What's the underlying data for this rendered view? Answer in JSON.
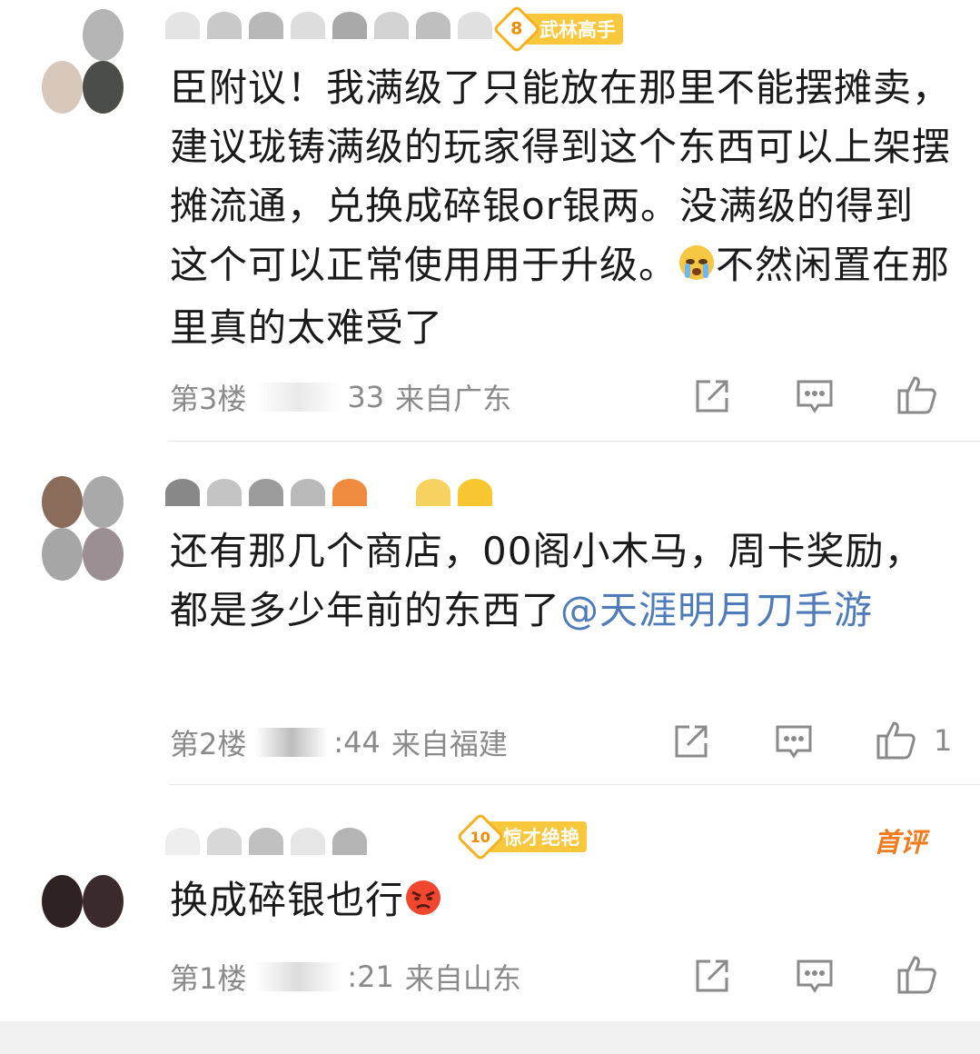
{
  "comments": [
    {
      "floor": "第3楼",
      "time": "33",
      "location": "来自广东",
      "badge_level": "8",
      "badge_title": "武林高手",
      "text": "臣附议！我满级了只能放在那里不能摆摊卖，建议珑铸满级的玩家得到这个东西可以上架摆摊流通，兑换成碎银or银两。没满级的得到这个可以正常使用用于升级。",
      "emoji": "crying-emoji",
      "text_after_emoji": "不然闲置在那里真的太难受了",
      "likes": ""
    },
    {
      "floor": "第2楼",
      "time": ":44",
      "location": "来自福建",
      "text": "还有那几个商店，00阁小木马，周卡奖励，都是多少年前的东西了",
      "mention": "@天涯明月刀手游",
      "likes": "1"
    },
    {
      "floor": "第1楼",
      "time": ":21",
      "location": "来自山东",
      "badge_level": "10",
      "badge_title": "惊才绝艳",
      "tag": "首评",
      "text": "换成碎银也行",
      "emoji": "angry-emoji",
      "likes": ""
    }
  ],
  "colors": {
    "badge": "#f8c73b",
    "mention": "#4f7cb8",
    "meta": "#8a8a8a",
    "first_tag": "#f07b1f"
  }
}
